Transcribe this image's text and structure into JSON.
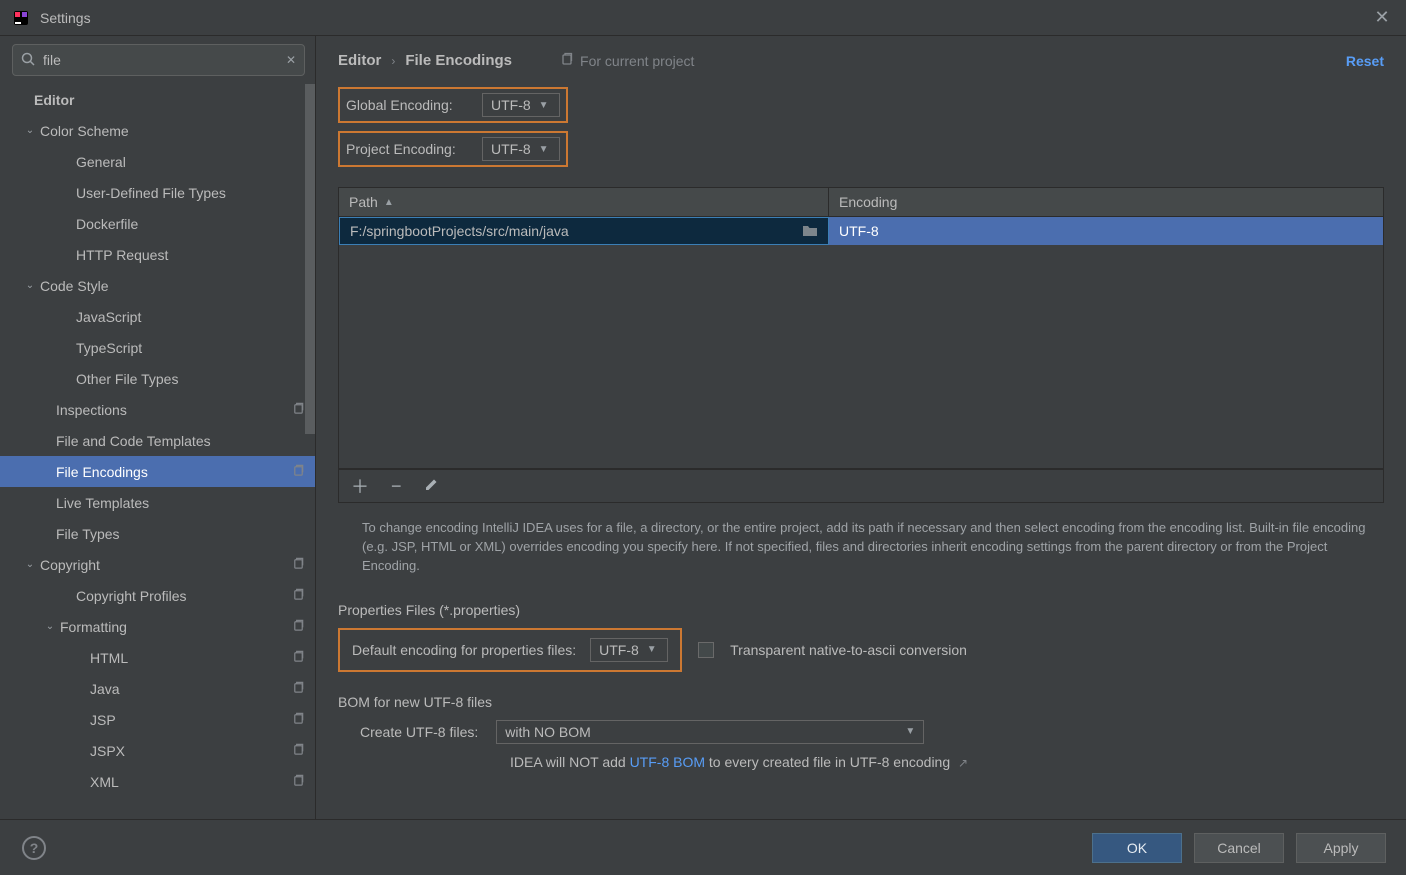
{
  "window": {
    "title": "Settings"
  },
  "search": {
    "value": "file"
  },
  "tree": {
    "sections": [
      {
        "label": "Editor",
        "indent": 34,
        "header": true
      },
      {
        "label": "Color Scheme",
        "indent": 40,
        "arrow": true
      },
      {
        "label": "General",
        "indent": 76
      },
      {
        "label": "User-Defined File Types",
        "indent": 76
      },
      {
        "label": "Dockerfile",
        "indent": 76
      },
      {
        "label": "HTTP Request",
        "indent": 76
      },
      {
        "label": "Code Style",
        "indent": 40,
        "arrow": true
      },
      {
        "label": "JavaScript",
        "indent": 76
      },
      {
        "label": "TypeScript",
        "indent": 76
      },
      {
        "label": "Other File Types",
        "indent": 76
      },
      {
        "label": "Inspections",
        "indent": 56,
        "badge": true
      },
      {
        "label": "File and Code Templates",
        "indent": 56
      },
      {
        "label": "File Encodings",
        "indent": 56,
        "badge": true,
        "selected": true
      },
      {
        "label": "Live Templates",
        "indent": 56
      },
      {
        "label": "File Types",
        "indent": 56
      },
      {
        "label": "Copyright",
        "indent": 40,
        "arrow": true,
        "badge": true
      },
      {
        "label": "Copyright Profiles",
        "indent": 76,
        "badge": true
      },
      {
        "label": "Formatting",
        "indent": 60,
        "arrow": true,
        "badge": true
      },
      {
        "label": "HTML",
        "indent": 90,
        "badge": true
      },
      {
        "label": "Java",
        "indent": 90,
        "badge": true
      },
      {
        "label": "JSP",
        "indent": 90,
        "badge": true
      },
      {
        "label": "JSPX",
        "indent": 90,
        "badge": true
      },
      {
        "label": "XML",
        "indent": 90,
        "badge": true
      }
    ]
  },
  "breadcrumb": {
    "parent": "Editor",
    "current": "File Encodings",
    "for_project": "For current project",
    "reset": "Reset"
  },
  "globalEncoding": {
    "label": "Global Encoding:",
    "value": "UTF-8"
  },
  "projectEncoding": {
    "label": "Project Encoding:",
    "value": "UTF-8"
  },
  "table": {
    "col_path": "Path",
    "col_enc": "Encoding",
    "rows": [
      {
        "path": "F:/springbootProjects/src/main/java",
        "encoding": "UTF-8"
      }
    ]
  },
  "helpText": "To change encoding IntelliJ IDEA uses for a file, a directory, or the entire project, add its path if necessary and then select encoding from the encoding list. Built-in file encoding (e.g. JSP, HTML or XML) overrides encoding you specify here. If not specified, files and directories inherit encoding settings from the parent directory or from the Project Encoding.",
  "properties": {
    "section_label": "Properties Files (*.properties)",
    "field_label": "Default encoding for properties files:",
    "value": "UTF-8",
    "checkbox_label": "Transparent native-to-ascii conversion"
  },
  "bom": {
    "section_label": "BOM for new UTF-8 files",
    "field_label": "Create UTF-8 files:",
    "value": "with NO BOM",
    "note_prefix": "IDEA will NOT add ",
    "note_link": "UTF-8 BOM",
    "note_suffix": " to every created file in UTF-8 encoding"
  },
  "buttons": {
    "ok": "OK",
    "cancel": "Cancel",
    "apply": "Apply"
  }
}
